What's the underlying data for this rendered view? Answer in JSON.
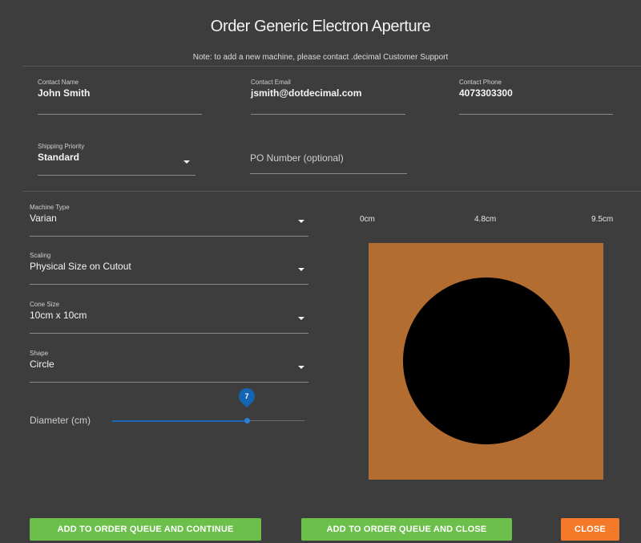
{
  "dialog": {
    "title": "Order Generic Electron Aperture",
    "note": "Note: to add a new machine, please contact .decimal Customer Support"
  },
  "contact": {
    "name": {
      "label": "Contact Name",
      "value": "John Smith"
    },
    "email": {
      "label": "Contact Email",
      "value": "jsmith@dotdecimal.com"
    },
    "phone": {
      "label": "Contact Phone",
      "value": "4073303300"
    }
  },
  "shipping": {
    "priority": {
      "label": "Shipping Priority",
      "value": "Standard"
    },
    "po_number": {
      "placeholder": "PO Number (optional)",
      "value": ""
    }
  },
  "machine": {
    "machine_type": {
      "label": "Machine Type",
      "value": "Varian"
    },
    "scaling": {
      "label": "Scaling",
      "value": "Physical Size on Cutout"
    },
    "cone_size": {
      "label": "Cone Size",
      "value": "10cm x 10cm"
    },
    "shape": {
      "label": "Shape",
      "value": "Circle"
    }
  },
  "diameter": {
    "label": "Diameter (cm)",
    "value": "7",
    "fraction": 0.7
  },
  "ruler": {
    "labels": [
      "0cm",
      "4.8cm",
      "9.5cm"
    ]
  },
  "preview": {
    "cutout_color": "#b46d31",
    "aperture_color": "#000000",
    "aperture_shape": "circle"
  },
  "actions": {
    "continue_label": "ADD TO ORDER QUEUE AND CONTINUE",
    "close_queue_label": "ADD TO ORDER QUEUE AND CLOSE",
    "close_label": "CLOSE"
  },
  "colors": {
    "dialog_bg": "#3d3d3d",
    "accent_blue": "#1466b5",
    "green_button": "#6bbf4a",
    "orange_button": "#f47a2a"
  }
}
